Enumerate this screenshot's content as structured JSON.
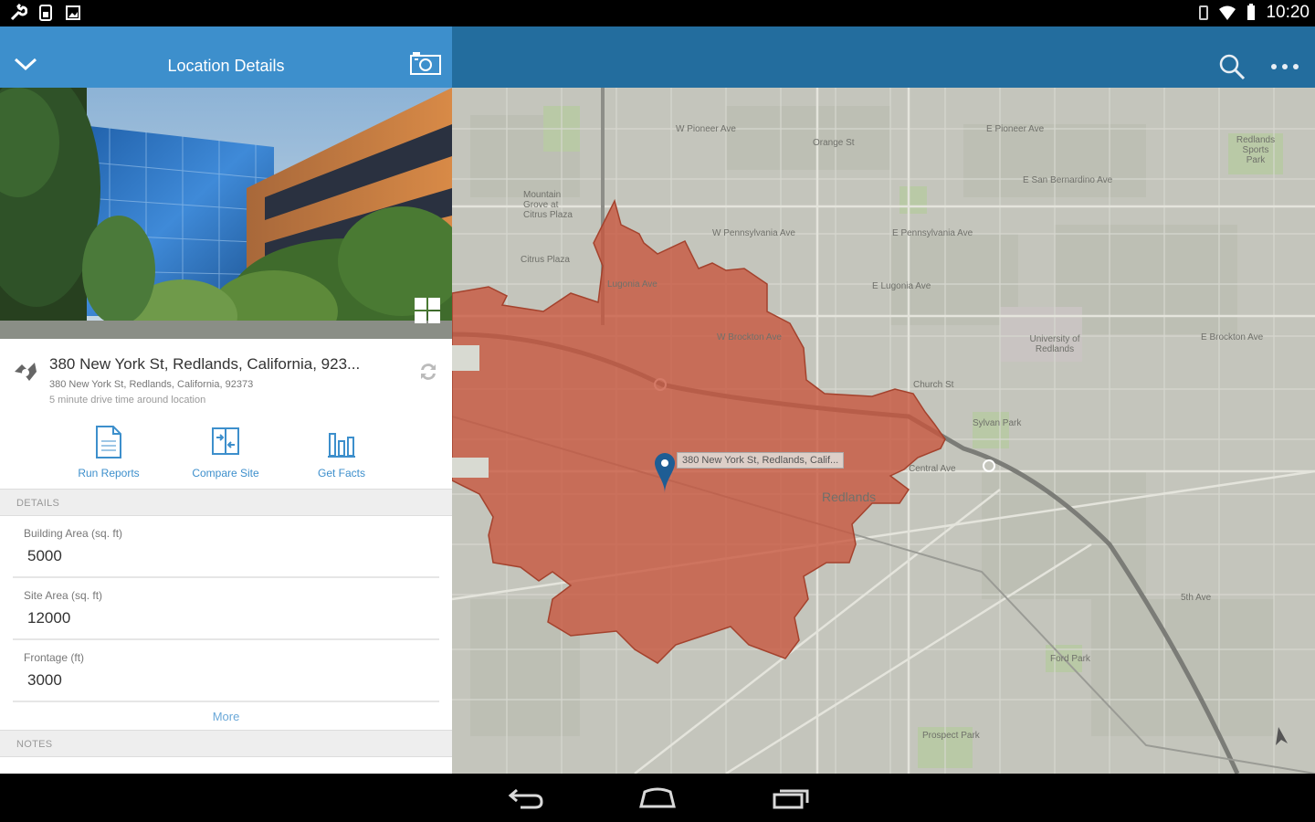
{
  "status_bar": {
    "time": "10:20",
    "left_icons": [
      "wrench-icon",
      "sim-icon",
      "image-icon"
    ],
    "right_icons": [
      "vibrate-icon",
      "wifi-icon",
      "battery-icon"
    ]
  },
  "panel": {
    "title": "Location Details",
    "address": {
      "name": "380 New York St, Redlands, California, 923...",
      "full": "380 New York St, Redlands, California, 92373",
      "subtitle": "5 minute drive time around location"
    },
    "actions": [
      {
        "label": "Run Reports",
        "icon": "report-icon"
      },
      {
        "label": "Compare Site",
        "icon": "compare-icon"
      },
      {
        "label": "Get Facts",
        "icon": "bar-chart-icon"
      }
    ],
    "details_header": "DETAILS",
    "fields": [
      {
        "label": "Building Area (sq. ft)",
        "value": "5000"
      },
      {
        "label": "Site Area (sq. ft)",
        "value": "12000"
      },
      {
        "label": "Frontage (ft)",
        "value": "3000"
      }
    ],
    "more_label": "More",
    "notes_header": "NOTES"
  },
  "map": {
    "callout": "380 New York St, Redlands, Calif...",
    "labels": [
      "W Pioneer Ave",
      "E Pioneer Ave",
      "Mountain Grove at Citrus Plaza",
      "Citrus Plaza",
      "W Pennsylvania Ave",
      "E Pennsylvania Ave",
      "E Lugonia Ave",
      "Lugonia Ave",
      "W Brockton Ave",
      "E Brockton Ave",
      "University of Redlands",
      "E San Bernardino Ave",
      "Redlands Sports Park",
      "Sylvan Park",
      "Central Ave",
      "Redlands",
      "Prospect Park",
      "Ford Park",
      "Orange St",
      "Church St",
      "5th Ave"
    ],
    "accent": "#c8553c"
  },
  "colors": {
    "panel_header": "#3d8fcc",
    "toolbar": "#236d9e",
    "drive_time_polygon": "#c8553c"
  }
}
